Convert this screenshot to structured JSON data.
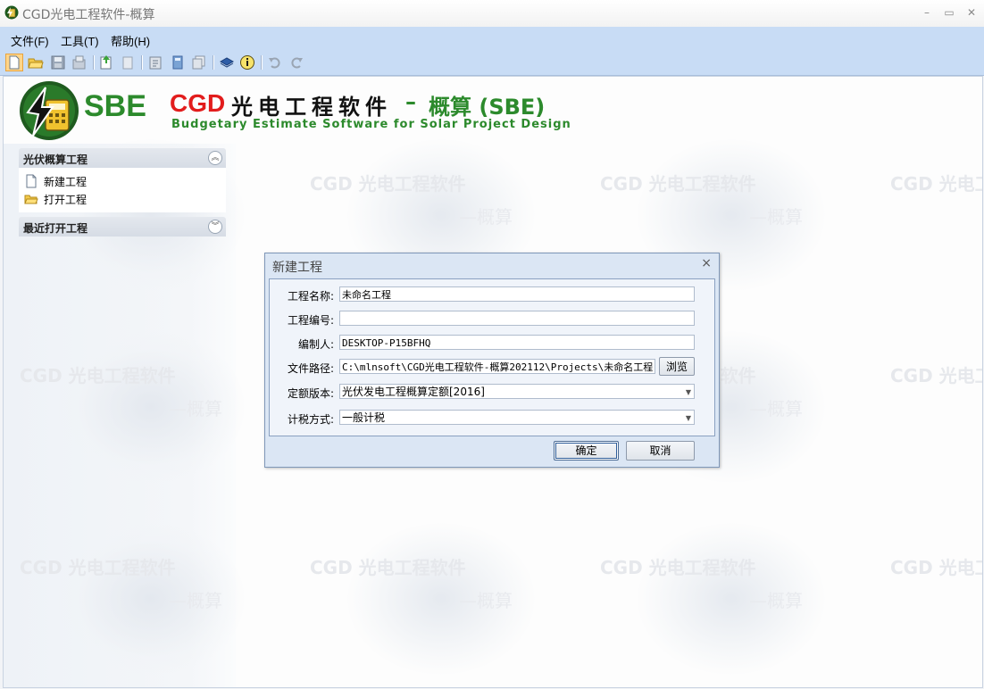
{
  "window": {
    "title": "CGD光电工程软件-概算",
    "controls": {
      "minimize": "–",
      "maximize": "▭",
      "close": "✕"
    }
  },
  "menu": [
    {
      "label": "文件(F)"
    },
    {
      "label": "工具(T)"
    },
    {
      "label": "帮助(H)"
    }
  ],
  "toolbar_icons": [
    "new-file-icon",
    "open-folder-icon",
    "save-icon",
    "save-as-icon",
    "import-icon",
    "export-icon",
    "report-icon",
    "calculator-icon",
    "copy-icon",
    "book-icon",
    "info-icon",
    "undo-icon",
    "redo-icon"
  ],
  "banner": {
    "sbe": "SBE",
    "cgd": "CGD",
    "product_zh": "光电工程软件",
    "dash": "–",
    "suffix": "概算 (SBE)",
    "subtitle_en": "Budgetary Estimate Software for Solar Project Design"
  },
  "watermark": {
    "title": "CGD 光电工程软件",
    "sub": "—概算"
  },
  "sidebar": {
    "panel1": {
      "title": "光伏概算工程",
      "toggle": "︽",
      "items": [
        {
          "label": "新建工程",
          "icon": "new-file-icon"
        },
        {
          "label": "打开工程",
          "icon": "open-folder-icon"
        }
      ]
    },
    "panel2": {
      "title": "最近打开工程",
      "toggle": "︾"
    }
  },
  "dialog": {
    "title": "新建工程",
    "close": "×",
    "fields": {
      "name": {
        "label": "工程名称:",
        "value": "未命名工程"
      },
      "code": {
        "label": "工程编号:",
        "value": ""
      },
      "author": {
        "label": "编制人:",
        "value": "DESKTOP-P15BFHQ"
      },
      "path": {
        "label": "文件路径:",
        "value": "C:\\mlnsoft\\CGD光电工程软件-概算202112\\Projects\\未命名工程."
      },
      "quota": {
        "label": "定额版本:",
        "value": "光伏发电工程概算定额[2016]"
      },
      "tax": {
        "label": "计税方式:",
        "value": "一般计税"
      }
    },
    "browse_label": "浏览",
    "ok_label": "确定",
    "cancel_label": "取消"
  },
  "colors": {
    "menubar": "#c8dcf5",
    "brand_green": "#2c8a2c",
    "brand_red": "#e21c1c"
  }
}
